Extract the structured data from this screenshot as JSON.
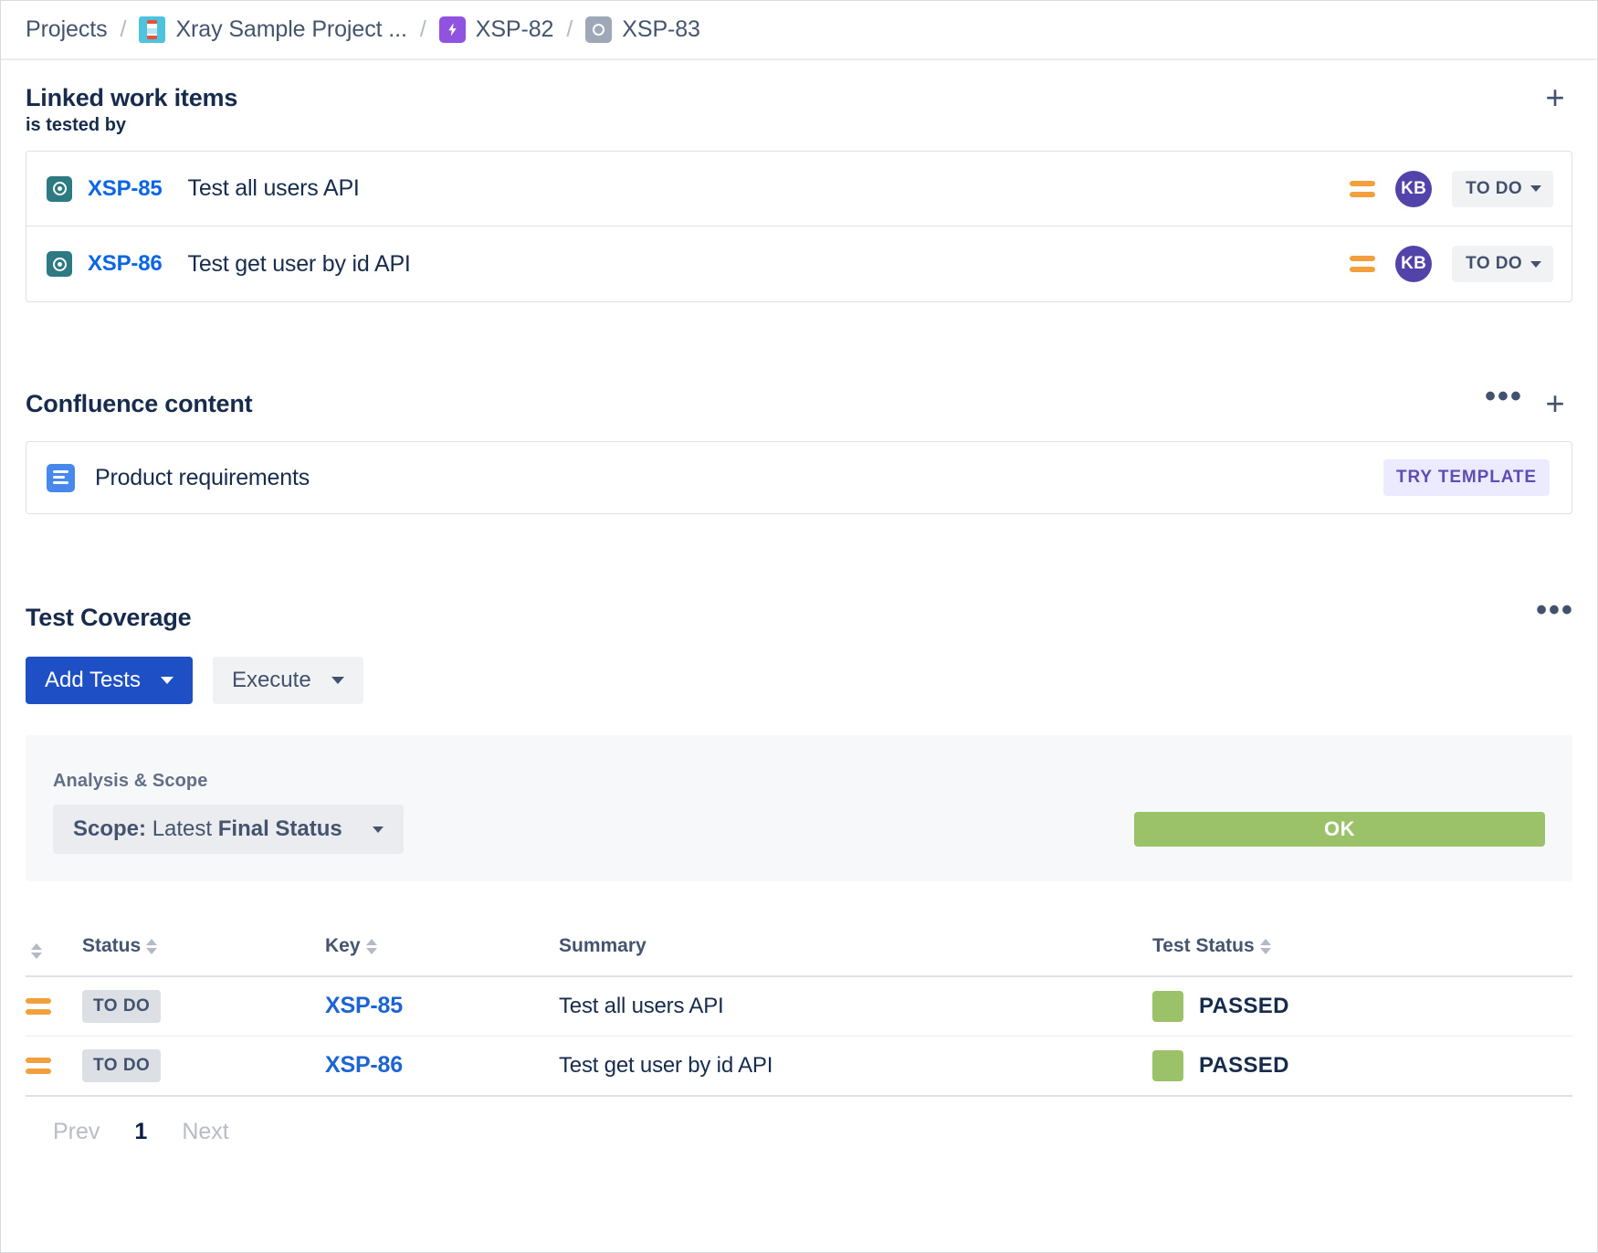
{
  "breadcrumb": {
    "items": [
      {
        "label": "Projects",
        "icon": null
      },
      {
        "label": "Xray Sample Project ...",
        "icon": "project-avatar-icon"
      },
      {
        "label": "XSP-82",
        "icon": "epic-bolt-icon"
      },
      {
        "label": "XSP-83",
        "icon": "test-grey-icon"
      }
    ],
    "separator": "/"
  },
  "linked_work_items": {
    "title": "Linked work items",
    "add_label": "+",
    "link_type": "is tested by",
    "rows": [
      {
        "icon": "test-teal-icon",
        "key": "XSP-85",
        "summary": "Test all users API",
        "priority_icon": "priority-medium-icon",
        "assignee_initials": "KB",
        "status": "TO DO"
      },
      {
        "icon": "test-teal-icon",
        "key": "XSP-86",
        "summary": "Test get user by id API",
        "priority_icon": "priority-medium-icon",
        "assignee_initials": "KB",
        "status": "TO DO"
      }
    ]
  },
  "confluence": {
    "title": "Confluence content",
    "more_label": "•••",
    "add_label": "+",
    "item": {
      "icon": "confluence-page-icon",
      "title": "Product requirements",
      "badge": "TRY TEMPLATE"
    }
  },
  "test_coverage": {
    "title": "Test Coverage",
    "more_label": "•••",
    "buttons": {
      "add_tests": "Add Tests",
      "execute": "Execute"
    },
    "analysis": {
      "label": "Analysis & Scope",
      "scope_prefix": "Scope:",
      "scope_middle": "Latest",
      "scope_suffix": "Final Status",
      "result": "OK",
      "result_color": "#9bc269"
    },
    "table": {
      "headers": {
        "priority": "",
        "status": "Status",
        "key": "Key",
        "summary": "Summary",
        "test_status": "Test Status"
      },
      "rows": [
        {
          "priority_icon": "priority-medium-icon",
          "status": "TO DO",
          "key": "XSP-85",
          "summary": "Test all users API",
          "test_status": "PASSED",
          "test_status_color": "#9bc269"
        },
        {
          "priority_icon": "priority-medium-icon",
          "status": "TO DO",
          "key": "XSP-86",
          "summary": "Test get user by id API",
          "test_status": "PASSED",
          "test_status_color": "#9bc269"
        }
      ]
    },
    "pagination": {
      "prev": "Prev",
      "current": "1",
      "next": "Next"
    }
  }
}
